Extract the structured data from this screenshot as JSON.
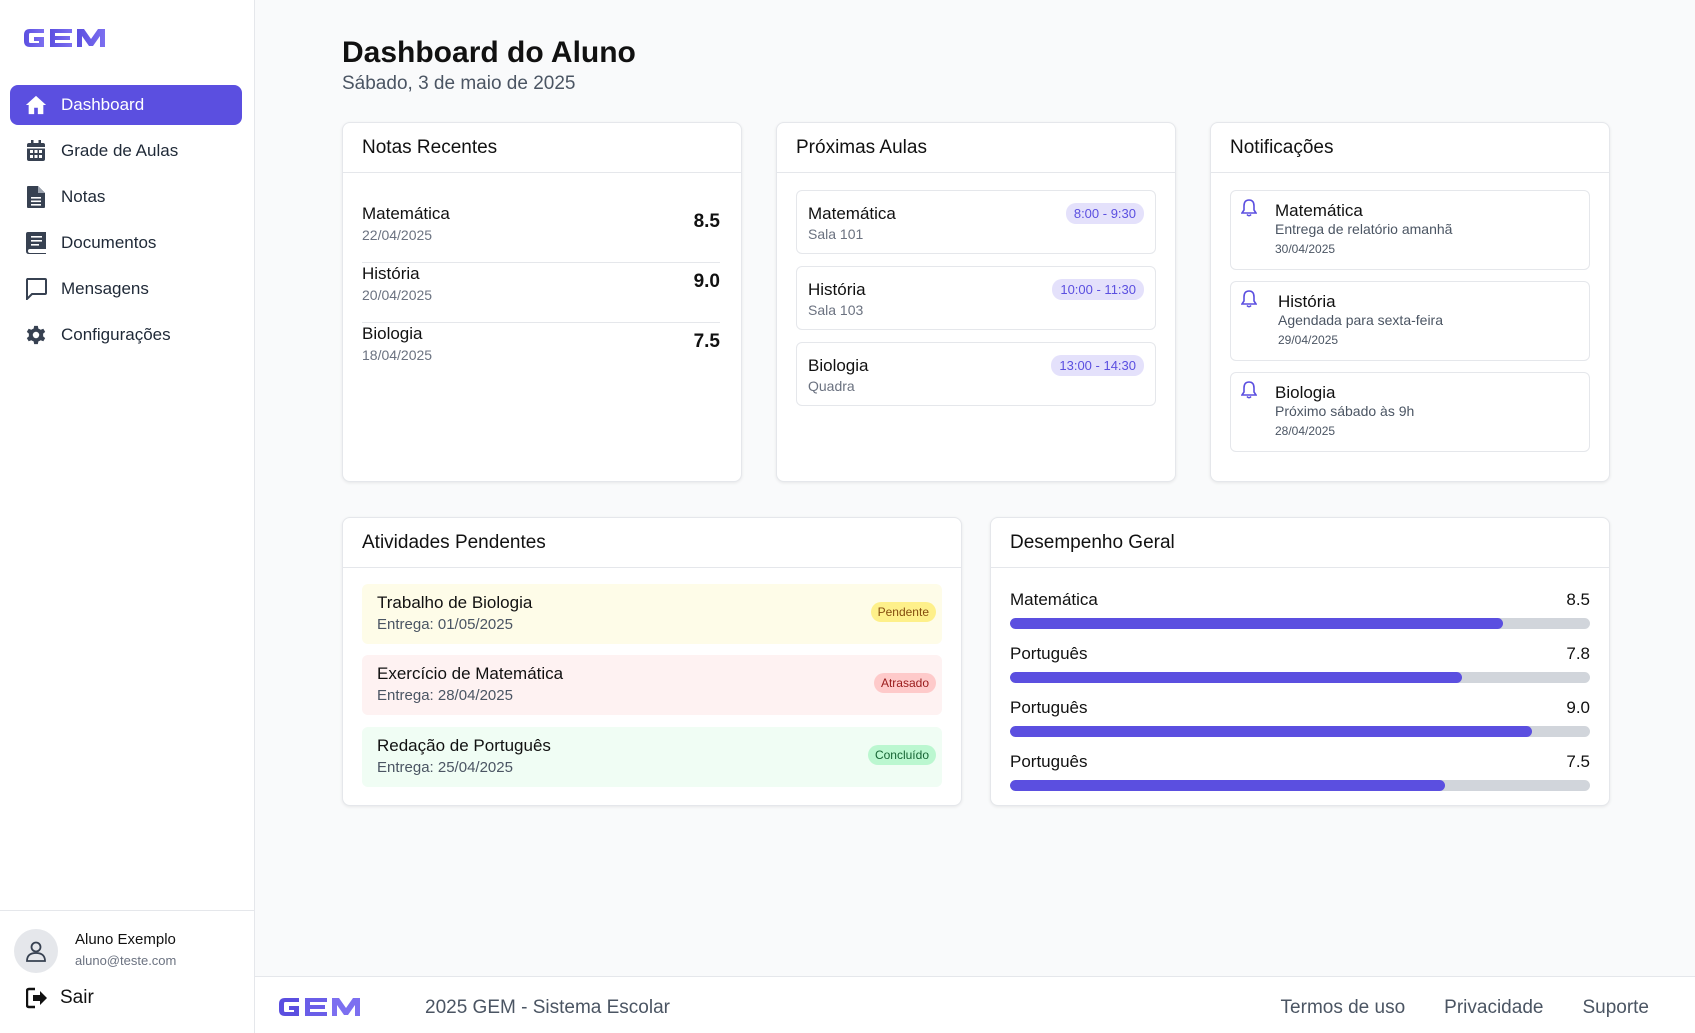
{
  "brand": {
    "logo_text": "GEM",
    "accent": "#5b4fe0"
  },
  "sidebar": {
    "items": [
      {
        "label": "Dashboard",
        "icon": "home-icon",
        "active": true
      },
      {
        "label": "Grade de Aulas",
        "icon": "calendar-icon"
      },
      {
        "label": "Notas",
        "icon": "document-icon"
      },
      {
        "label": "Documentos",
        "icon": "book-icon"
      },
      {
        "label": "Mensagens",
        "icon": "chat-icon"
      },
      {
        "label": "Configurações",
        "icon": "gear-icon"
      }
    ],
    "user": {
      "name": "Aluno Exemplo",
      "email": "aluno@teste.com"
    },
    "logout_label": "Sair"
  },
  "header": {
    "title": "Dashboard do Aluno",
    "date": "Sábado, 3 de maio de 2025"
  },
  "notas_recentes": {
    "title": "Notas Recentes",
    "items": [
      {
        "subject": "Matemática",
        "date": "22/04/2025",
        "grade": "8.5"
      },
      {
        "subject": "História",
        "date": "20/04/2025",
        "grade": "9.0"
      },
      {
        "subject": "Biologia",
        "date": "18/04/2025",
        "grade": "7.5"
      }
    ]
  },
  "proximas_aulas": {
    "title": "Próximas Aulas",
    "items": [
      {
        "subject": "Matemática",
        "room": "Sala 101",
        "time": "8:00 - 9:30"
      },
      {
        "subject": "História",
        "room": "Sala 103",
        "time": "10:00 - 11:30"
      },
      {
        "subject": "Biologia",
        "room": "Quadra",
        "time": "13:00 - 14:30"
      }
    ]
  },
  "notificacoes": {
    "title": "Notificações",
    "items": [
      {
        "subject": "Matemática",
        "message": "Entrega de relatório amanhã",
        "date": "30/04/2025"
      },
      {
        "subject": "História",
        "message": "Agendada para sexta-feira",
        "date": "29/04/2025"
      },
      {
        "subject": "Biologia",
        "message": "Próximo sábado às 9h",
        "date": "28/04/2025"
      }
    ]
  },
  "atividades": {
    "title": "Atividades Pendentes",
    "items": [
      {
        "title": "Trabalho de Biologia",
        "due": "Entrega: 01/05/2025",
        "status": "Pendente",
        "bg": "#fefce8",
        "badge_bg": "#fef08a",
        "badge_fg": "#854d0e"
      },
      {
        "title": "Exercício de Matemática",
        "due": "Entrega: 28/04/2025",
        "status": "Atrasado",
        "bg": "#fef2f2",
        "badge_bg": "#fecaca",
        "badge_fg": "#991b1b"
      },
      {
        "title": "Redação de Português",
        "due": "Entrega: 25/04/2025",
        "status": "Concluído",
        "bg": "#f0fdf4",
        "badge_bg": "#bbf7d0",
        "badge_fg": "#166534"
      }
    ]
  },
  "desempenho": {
    "title": "Desempenho Geral",
    "max": 10,
    "items": [
      {
        "subject": "Matemática",
        "value": "8.5"
      },
      {
        "subject": "Português",
        "value": "7.8"
      },
      {
        "subject": "Português",
        "value": "9.0"
      },
      {
        "subject": "Português",
        "value": "7.5"
      }
    ]
  },
  "footer": {
    "logo_text": "GEM",
    "copyright": "2025 GEM - Sistema Escolar",
    "links": [
      "Termos de uso",
      "Privacidade",
      "Suporte"
    ]
  }
}
